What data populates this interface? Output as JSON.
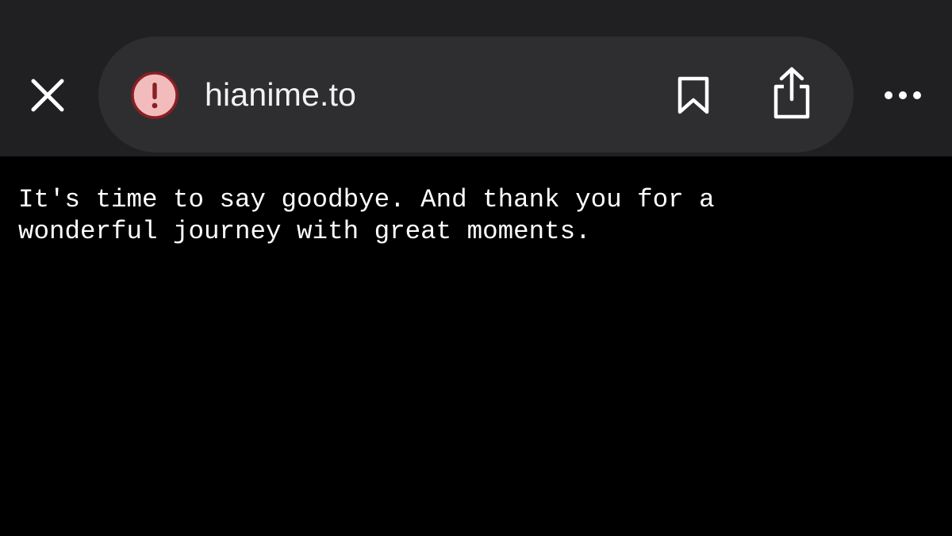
{
  "browser": {
    "url": "hianime.to",
    "icons": {
      "close": "close-icon",
      "security": "warning-circle-icon",
      "bookmark": "bookmark-icon",
      "share": "share-icon",
      "more": "more-horizontal-icon"
    },
    "colors": {
      "toolbar_background": "#202022",
      "address_bar_background": "#2e2e31",
      "warning_icon_fill": "#f2bcbc",
      "warning_icon_accent": "#8a1f24",
      "icon_color": "#ffffff"
    }
  },
  "page": {
    "message_line1": "It's time to say goodbye. And thank you for a",
    "message_line2": "wonderful journey with great moments.",
    "colors": {
      "background": "#000000",
      "text": "#ffffff"
    }
  }
}
